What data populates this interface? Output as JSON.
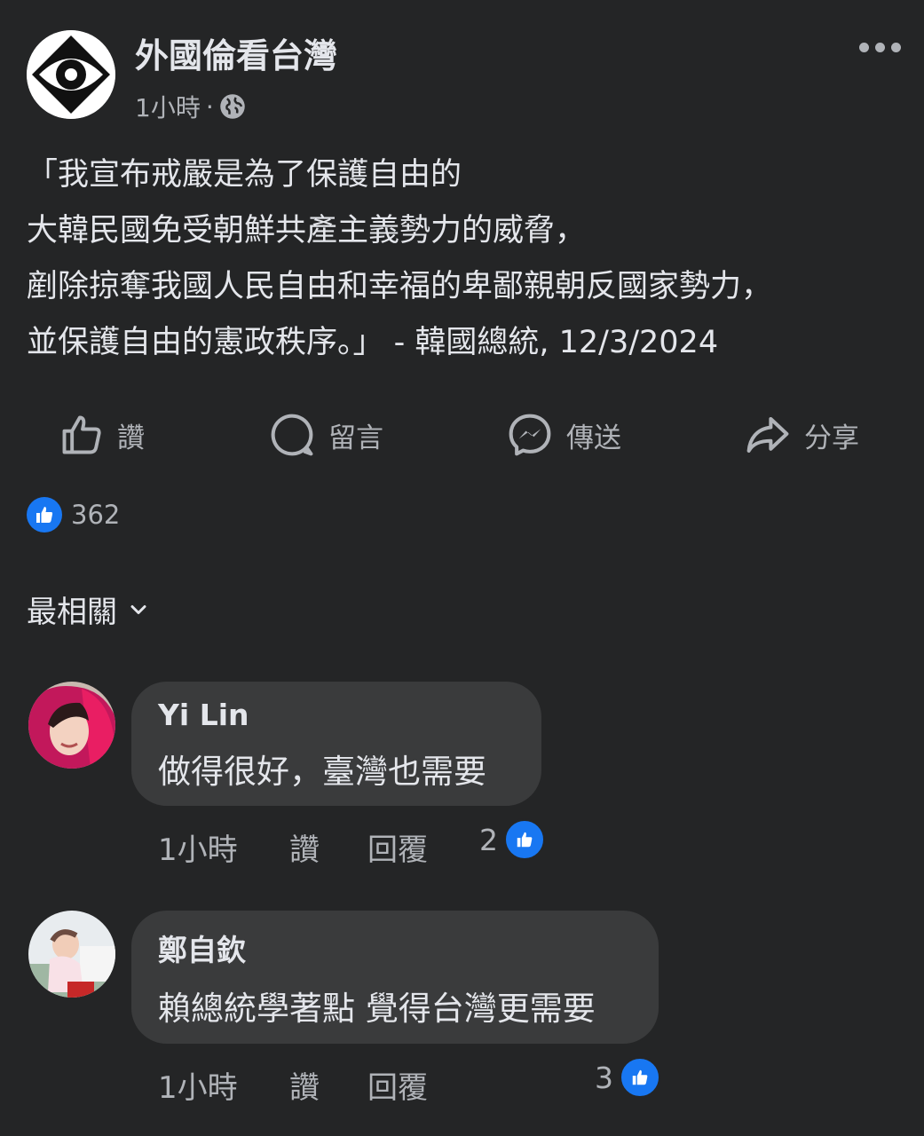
{
  "post": {
    "page_name": "外國倫看台灣",
    "time": "1小時",
    "separator": "·",
    "privacy_icon": "globe-icon",
    "more_icon": "more-horizontal-icon",
    "text_lines": [
      "「我宣布戒嚴是為了保護自由的",
      "大韓民國免受朝鮮共產主義勢力的威脅，",
      "剷除掠奪我國人民自由和幸福的卑鄙親朝反國家勢力，",
      "並保護自由的憲政秩序。」 - 韓國總統, 12/3/2024"
    ]
  },
  "actions": {
    "like": "讚",
    "comment": "留言",
    "send": "傳送",
    "share": "分享"
  },
  "reactions": {
    "icon": "like-reaction-icon",
    "count": "362"
  },
  "sort": {
    "label": "最相關",
    "icon": "chevron-down-icon"
  },
  "comments": [
    {
      "author": "Yi Lin",
      "text": "做得很好，臺灣也需要",
      "time": "1小時",
      "like_label": "讚",
      "reply_label": "回覆",
      "reaction_count": "2"
    },
    {
      "author": "鄭自欽",
      "text": "賴總統學著點 覺得台灣更需要",
      "time": "1小時",
      "like_label": "讚",
      "reply_label": "回覆",
      "reaction_count": "3"
    }
  ],
  "colors": {
    "background": "#242526",
    "bubble": "#3a3b3c",
    "text_primary": "#e4e6eb",
    "text_secondary": "#b0b3b8",
    "like_blue": "#1877f2"
  }
}
